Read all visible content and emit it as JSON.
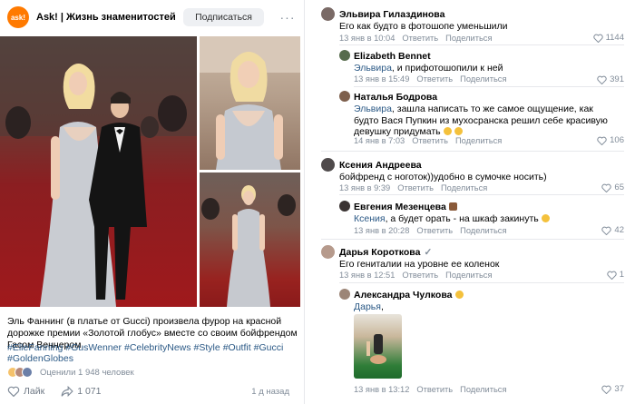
{
  "post": {
    "avatar_text": "ask!",
    "title": "Ask! | Жизнь знаменитостей",
    "subscribe_label": "Подписаться",
    "more_label": "···",
    "caption": "Эль Фаннинг (в платье от Gucci) произвела фурор на красной дорожке премии «Золотой глобус» вместе со своим бойфрендом Гасом Веннером.",
    "tags_line1": [
      "#ElleFanning",
      "#GusWenner",
      "#CelebrityNews",
      "#Style",
      "#Outfit",
      "#Gucci"
    ],
    "tags_line2": [
      "#GoldenGlobes"
    ],
    "rated_text": "Оценили 1 948 человек",
    "like_label": "Лайк",
    "share_count": "1 071",
    "time": "1 д назад"
  },
  "colors": {
    "accent": "#2a5885",
    "brand_orange": "#ff7a00",
    "muted": "#818c99"
  },
  "comments": [
    {
      "name": "Эльвира Гилаздинова",
      "text": "Его как будто в фотошопе уменьшили",
      "date": "13 янв в 10:04",
      "reply": "Ответить",
      "share": "Поделиться",
      "likes": "1144"
    },
    {
      "name": "Elizabeth Bennet",
      "mention": "Эльвира",
      "text": ", и прифотошопили к ней",
      "date": "13 янв в 15:49",
      "reply": "Ответить",
      "share": "Поделиться",
      "likes": "391"
    },
    {
      "name": "Наталья Бодрова",
      "mention": "Эльвира",
      "text": ", зашла написать то же самое ощущение, как будто Вася Пупкин из мухосранска решил себе красивую девушку придумать",
      "date": "14 янв в 7:03",
      "reply": "Ответить",
      "share": "Поделиться",
      "likes": "106"
    },
    {
      "name": "Ксения Андреева",
      "text": "бойфренд с ноготок))удобно в сумочке носить)",
      "date": "13 янв в 9:39",
      "reply": "Ответить",
      "share": "Поделиться",
      "likes": "65"
    },
    {
      "name": "Евгения Мезенцева",
      "mention": "Ксения",
      "text": ", а будет орать - на шкаф закинуть",
      "date": "13 янв в 20:28",
      "reply": "Ответить",
      "share": "Поделиться",
      "likes": "42"
    },
    {
      "name": "Дарья Короткова",
      "text": "Его гениталии на уровне ее коленок",
      "date": "13 янв в 12:51",
      "reply": "Ответить",
      "share": "Поделиться",
      "likes": "1"
    },
    {
      "name": "Александра Чулкова",
      "mention": "Дарья",
      "text": ",",
      "date": "13 янв в 13:12",
      "reply": "Ответить",
      "share": "Поделиться",
      "likes": "37"
    }
  ]
}
